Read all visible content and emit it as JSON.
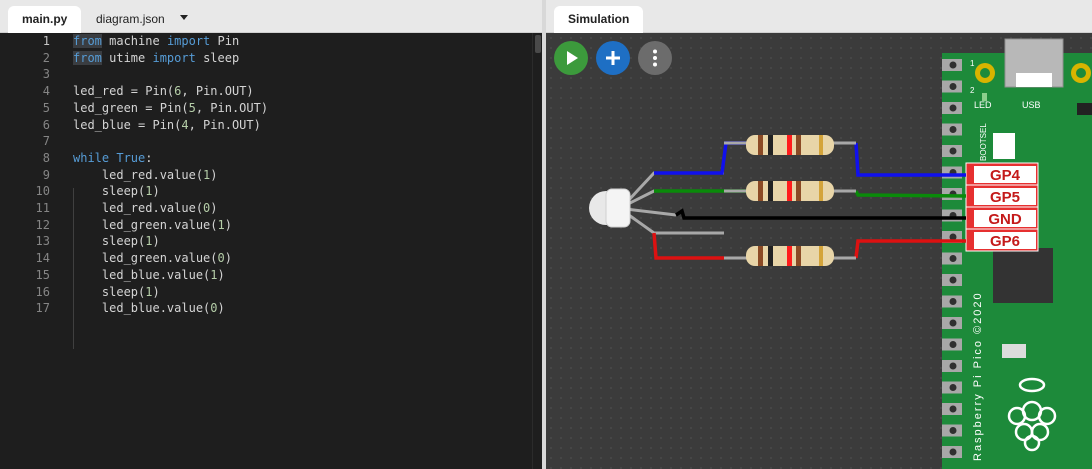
{
  "editor": {
    "tabs": [
      {
        "label": "main.py",
        "active": true
      },
      {
        "label": "diagram.json",
        "active": false
      }
    ],
    "lines": [
      {
        "n": "1",
        "parts": [
          [
            "kw hl",
            "from"
          ],
          [
            "",
            " machine "
          ],
          [
            "kw",
            "import"
          ],
          [
            "",
            " Pin"
          ]
        ]
      },
      {
        "n": "2",
        "parts": [
          [
            "kw hl",
            "from"
          ],
          [
            "",
            " utime "
          ],
          [
            "kw",
            "import"
          ],
          [
            "",
            " sleep"
          ]
        ]
      },
      {
        "n": "3",
        "parts": []
      },
      {
        "n": "4",
        "parts": [
          [
            "",
            "led_red = Pin("
          ],
          [
            "num",
            "6"
          ],
          [
            "",
            ", Pin.OUT)"
          ]
        ]
      },
      {
        "n": "5",
        "parts": [
          [
            "",
            "led_green = Pin("
          ],
          [
            "num",
            "5"
          ],
          [
            "",
            ", Pin.OUT)"
          ]
        ]
      },
      {
        "n": "6",
        "parts": [
          [
            "",
            "led_blue = Pin("
          ],
          [
            "num",
            "4"
          ],
          [
            "",
            ", Pin.OUT)"
          ]
        ]
      },
      {
        "n": "7",
        "parts": []
      },
      {
        "n": "8",
        "parts": [
          [
            "kw",
            "while"
          ],
          [
            "",
            " "
          ],
          [
            "kw",
            "True"
          ],
          [
            "",
            ":"
          ]
        ]
      },
      {
        "n": "9",
        "parts": [
          [
            "",
            "    led_red.value("
          ],
          [
            "num",
            "1"
          ],
          [
            "",
            ")"
          ]
        ]
      },
      {
        "n": "10",
        "parts": [
          [
            "",
            "    sleep("
          ],
          [
            "num",
            "1"
          ],
          [
            "",
            ")"
          ]
        ]
      },
      {
        "n": "11",
        "parts": [
          [
            "",
            "    led_red.value("
          ],
          [
            "num",
            "0"
          ],
          [
            "",
            ")"
          ]
        ]
      },
      {
        "n": "12",
        "parts": [
          [
            "",
            "    led_green.value("
          ],
          [
            "num",
            "1"
          ],
          [
            "",
            ")"
          ]
        ]
      },
      {
        "n": "13",
        "parts": [
          [
            "",
            "    sleep("
          ],
          [
            "num",
            "1"
          ],
          [
            "",
            ")"
          ]
        ]
      },
      {
        "n": "14",
        "parts": [
          [
            "",
            "    led_green.value("
          ],
          [
            "num",
            "0"
          ],
          [
            "",
            ")"
          ]
        ]
      },
      {
        "n": "15",
        "parts": [
          [
            "",
            "    led_blue.value("
          ],
          [
            "num",
            "1"
          ],
          [
            "",
            ")"
          ]
        ]
      },
      {
        "n": "16",
        "parts": [
          [
            "",
            "    sleep("
          ],
          [
            "num",
            "1"
          ],
          [
            "",
            ")"
          ]
        ]
      },
      {
        "n": "17",
        "parts": [
          [
            "",
            "    led_blue.value("
          ],
          [
            "num",
            "0"
          ],
          [
            "",
            ")"
          ]
        ]
      }
    ]
  },
  "simulation": {
    "tab_label": "Simulation",
    "controls": {
      "play": "play-icon",
      "add": "plus-icon",
      "more": "more-vertical-icon"
    },
    "board": {
      "name": "Raspberry Pi Pico ©2020",
      "led_label": "LED",
      "usb_label": "USB",
      "bootsel_label": "BOOTSEL",
      "pin_numbers": [
        "1",
        "2"
      ],
      "pin_labels": [
        "GP4",
        "GP5",
        "GND",
        "GP6"
      ]
    },
    "wire_colors": {
      "blue": "#1010ee",
      "green": "#0a8a0a",
      "black": "#000000",
      "red": "#dd1111"
    }
  }
}
